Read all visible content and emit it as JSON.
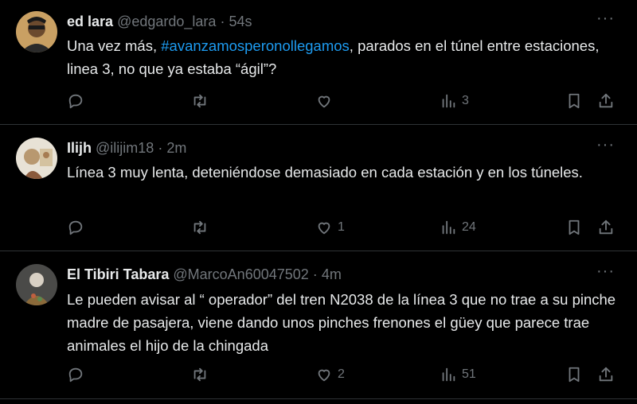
{
  "tweets": [
    {
      "name": "ed lara",
      "handle": "@edgardo_lara",
      "time": "54s",
      "body_pre": "Una vez más, ",
      "hashtag": "#avanzamosperonollegamos",
      "body_post": ", parados en el túnel entre estaciones, linea 3, no que ya estaba “ágil”?",
      "likes": "",
      "views": "3"
    },
    {
      "name": "Ilijh",
      "handle": "@ilijim18",
      "time": "2m",
      "body": "Línea 3 muy lenta, deteniéndose demasiado en cada estación y en los túneles.",
      "likes": "1",
      "views": "24"
    },
    {
      "name": "El Tibiri Tabara",
      "handle": "@MarcoAn60047502",
      "time": "4m",
      "body": "Le pueden avisar al “ operador” del tren N2038 de la línea 3 que no trae a su pinche madre de pasajera, viene dando unos pinches frenones el güey que parece trae animales el hijo de la chingada",
      "likes": "2",
      "views": "51"
    }
  ],
  "separator": "·",
  "more": "···",
  "colors": {
    "accent": "#1d9bf0",
    "muted": "#71767b",
    "text": "#e7e9ea",
    "bg": "#000000",
    "border": "#2f3336"
  },
  "icons": [
    "reply-icon",
    "retweet-icon",
    "like-icon",
    "views-icon",
    "bookmark-icon",
    "share-icon",
    "more-icon"
  ]
}
